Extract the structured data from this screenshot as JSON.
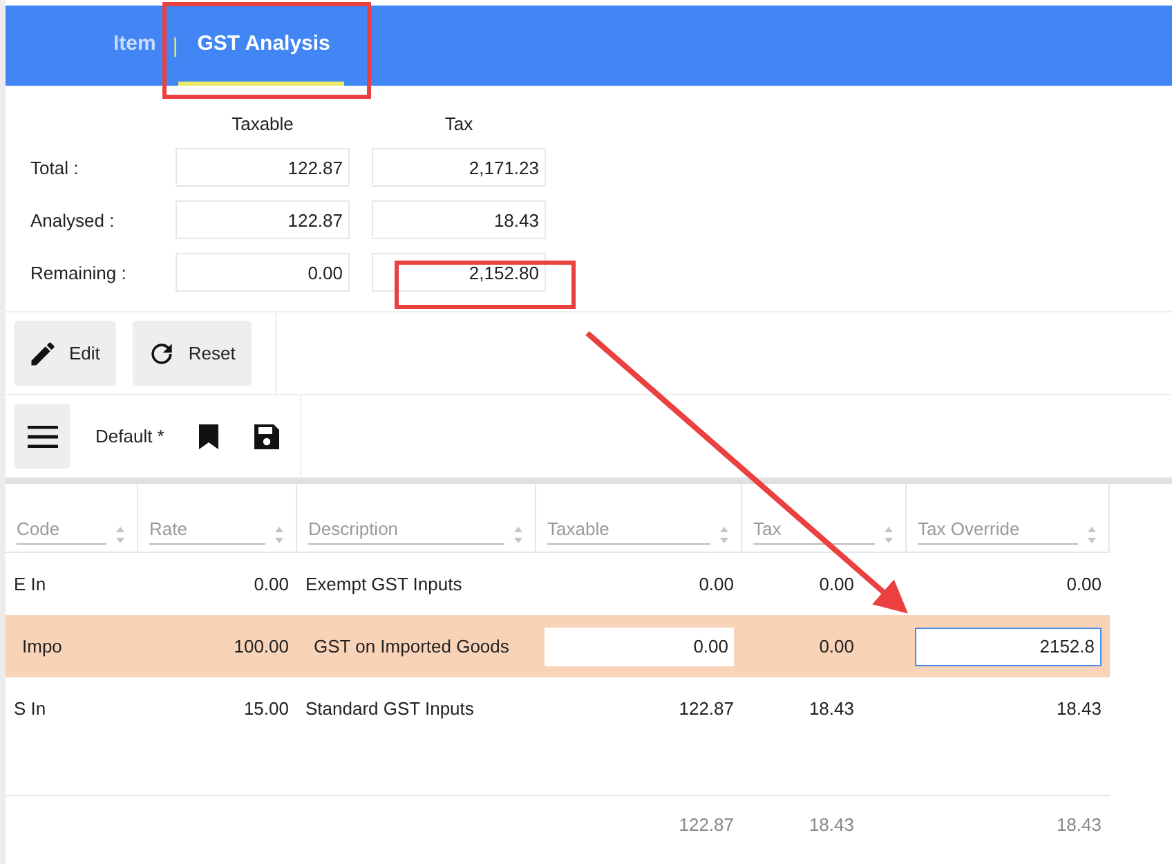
{
  "tabs": [
    {
      "label": "Item",
      "selected": false
    },
    {
      "label": "GST Analysis",
      "selected": true
    }
  ],
  "tab_separator": "|",
  "summary": {
    "columns": [
      "Taxable",
      "Tax"
    ],
    "rows": [
      {
        "label": "Total :",
        "taxable": "122.87",
        "tax": "2,171.23"
      },
      {
        "label": "Analysed :",
        "taxable": "122.87",
        "tax": "18.43"
      },
      {
        "label": "Remaining :",
        "taxable": "0.00",
        "tax": "2,152.80"
      }
    ]
  },
  "actions": [
    {
      "kind": "edit",
      "label": "Edit"
    },
    {
      "kind": "reset",
      "label": "Reset"
    }
  ],
  "layout_bar": {
    "view_name": "Default *"
  },
  "table": {
    "columns": [
      "Code",
      "Rate",
      "Description",
      "Taxable",
      "Tax",
      "Tax Override"
    ],
    "rows": [
      {
        "code": "E In",
        "rate": "0.00",
        "description": "Exempt GST Inputs",
        "taxable": "0.00",
        "tax": "0.00",
        "tax_override": "0.00",
        "selected": false
      },
      {
        "code": "Impo",
        "rate": "100.00",
        "description": "GST on Imported Goods",
        "taxable": "0.00",
        "tax": "0.00",
        "tax_override": "2152.8",
        "selected": true
      },
      {
        "code": "S In",
        "rate": "15.00",
        "description": "Standard GST Inputs",
        "taxable": "122.87",
        "tax": "18.43",
        "tax_override": "18.43",
        "selected": false
      }
    ],
    "totals": {
      "taxable": "122.87",
      "tax": "18.43",
      "tax_override": "18.43"
    }
  }
}
